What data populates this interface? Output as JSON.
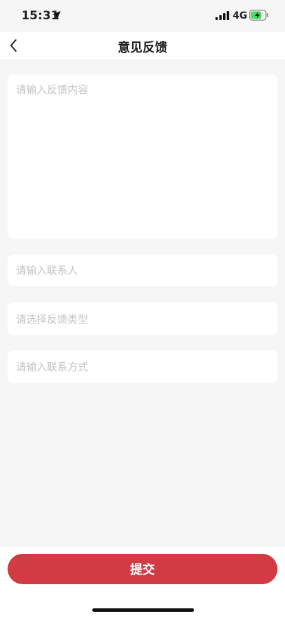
{
  "status_bar": {
    "time": "15:31",
    "network": "4G",
    "battery_charge_fraction": 0.75,
    "battery_color": "#4cd964",
    "icons": [
      "location-arrow-icon",
      "signal-icon",
      "battery-charging-icon"
    ]
  },
  "header": {
    "title": "意见反馈",
    "back_icon": "chevron-left-icon"
  },
  "form": {
    "feedback_placeholder": "请输入反馈内容",
    "contact_placeholder": "请输入联系人",
    "type_placeholder": "请选择反馈类型",
    "method_placeholder": "请输入联系方式"
  },
  "footer": {
    "submit_label": "提交",
    "accent_color": "#d23a44"
  }
}
